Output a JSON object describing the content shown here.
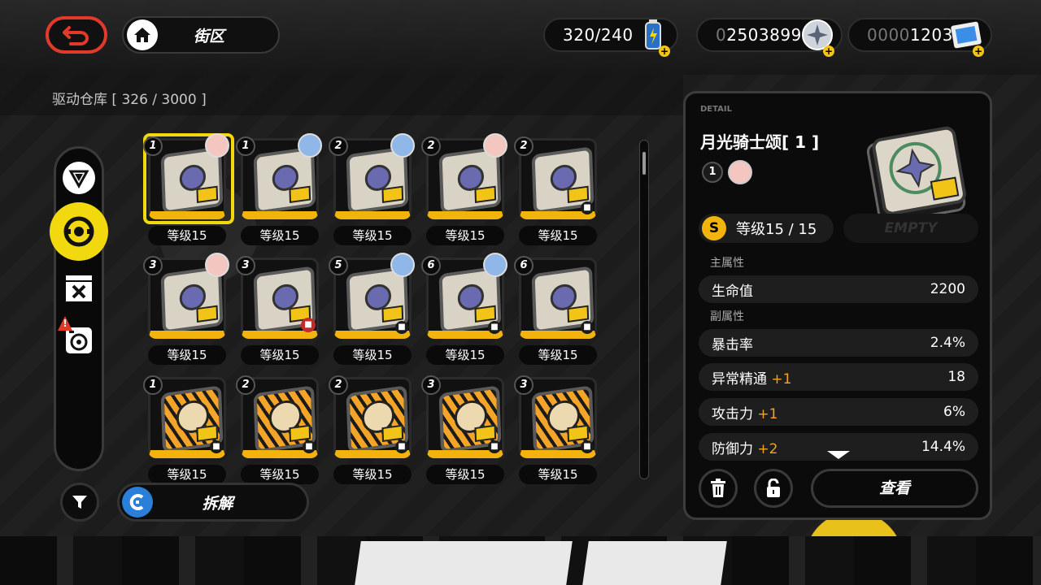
{
  "header": {
    "back_label": "",
    "location": "街区",
    "battery": {
      "value": "320/240",
      "icon": "battery-icon"
    },
    "dennies": {
      "prefix": "0",
      "value": "2503899",
      "icon": "dennies-coin-icon"
    },
    "polychrome": {
      "prefix": "0000",
      "value": "1203",
      "icon": "film-ticket-icon"
    }
  },
  "inventory": {
    "title": "驱动仓库 [ 326 / 3000 ]"
  },
  "sidebar": {
    "items": [
      {
        "name": "sidebar-item-w-engine",
        "icon": "triangle-emblem-icon"
      },
      {
        "name": "sidebar-item-disk-drive",
        "icon": "disk-drive-icon",
        "active": true
      },
      {
        "name": "sidebar-item-bangboo",
        "icon": "crossed-box-icon"
      },
      {
        "name": "sidebar-item-camera",
        "icon": "camera-icon",
        "badge": "!"
      }
    ]
  },
  "cards": [
    {
      "slot": "1",
      "avatar": "pink",
      "level": "等级15",
      "type": "moon",
      "selected": true,
      "mark": ""
    },
    {
      "slot": "1",
      "avatar": "blue",
      "level": "等级15",
      "type": "moon",
      "mark": ""
    },
    {
      "slot": "2",
      "avatar": "blue",
      "level": "等级15",
      "type": "moon",
      "mark": ""
    },
    {
      "slot": "2",
      "avatar": "pink",
      "level": "等级15",
      "type": "moon",
      "mark": ""
    },
    {
      "slot": "2",
      "avatar": "",
      "level": "等级15",
      "type": "moon",
      "mark": "lock"
    },
    {
      "slot": "3",
      "avatar": "pink",
      "level": "等级15",
      "type": "moon",
      "mark": ""
    },
    {
      "slot": "3",
      "avatar": "",
      "level": "等级15",
      "type": "moon",
      "mark": "trash"
    },
    {
      "slot": "5",
      "avatar": "blue",
      "level": "等级15",
      "type": "moon",
      "mark": "lock"
    },
    {
      "slot": "6",
      "avatar": "blue",
      "level": "等级15",
      "type": "moon",
      "mark": "lock"
    },
    {
      "slot": "6",
      "avatar": "",
      "level": "等级15",
      "type": "moon",
      "mark": "lock"
    },
    {
      "slot": "1",
      "avatar": "",
      "level": "等级15",
      "type": "tiger",
      "mark": "lock"
    },
    {
      "slot": "2",
      "avatar": "",
      "level": "等级15",
      "type": "tiger",
      "mark": "lock"
    },
    {
      "slot": "2",
      "avatar": "",
      "level": "等级15",
      "type": "tiger",
      "mark": "lock"
    },
    {
      "slot": "3",
      "avatar": "",
      "level": "等级15",
      "type": "tiger",
      "mark": "lock"
    },
    {
      "slot": "3",
      "avatar": "",
      "level": "等级15",
      "type": "tiger",
      "mark": "lock"
    }
  ],
  "bottom": {
    "disassemble_label": "拆解"
  },
  "detail": {
    "caption": "DETAIL",
    "name": "月光骑士颂[ 1 ]",
    "slot": "1",
    "rank": "S",
    "level": "等级15 / 15",
    "empty_label": "EMPTY",
    "main_stat_label": "主属性",
    "main_stat": {
      "name": "生命值",
      "value": "2200"
    },
    "sub_stat_label": "副属性",
    "sub_stats": [
      {
        "name": "暴击率",
        "plus": "",
        "value": "2.4%"
      },
      {
        "name": "异常精通",
        "plus": "+1",
        "value": "18"
      },
      {
        "name": "攻击力",
        "plus": "+1",
        "value": "6%"
      },
      {
        "name": "防御力",
        "plus": "+2",
        "value": "14.4%"
      }
    ],
    "view_label": "查看"
  },
  "colors": {
    "accent_yellow": "#f2d80e",
    "rank_gold": "#f2b40c",
    "back_red": "#e23a2a",
    "substat_orange": "#f2a51a"
  }
}
